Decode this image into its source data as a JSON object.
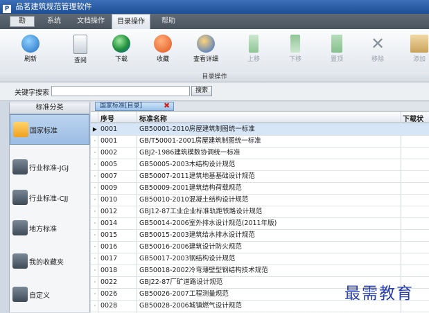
{
  "window": {
    "title": "品茗建筑规范管理软件"
  },
  "menubar": {
    "app_button": "勘",
    "items": [
      "系统",
      "文档操作",
      "目录操作",
      "帮助"
    ],
    "active": "目录操作"
  },
  "toolbar": {
    "buttons": [
      {
        "label": "刷新",
        "icon": "refresh-icon",
        "enabled": true
      },
      {
        "label": "查阅",
        "icon": "document-icon",
        "enabled": true
      },
      {
        "label": "下载",
        "icon": "globe-download-icon",
        "enabled": true
      },
      {
        "label": "收藏",
        "icon": "heart-icon",
        "enabled": true
      },
      {
        "label": "查看详细",
        "icon": "detail-icon",
        "enabled": true
      },
      {
        "label": "上移",
        "icon": "arrow-up-icon",
        "enabled": false
      },
      {
        "label": "下移",
        "icon": "arrow-down-icon",
        "enabled": false
      },
      {
        "label": "置顶",
        "icon": "arrow-top-icon",
        "enabled": false
      },
      {
        "label": "移除",
        "icon": "remove-icon",
        "enabled": false
      },
      {
        "label": "添加",
        "icon": "add-icon",
        "enabled": false
      }
    ],
    "group_label": "目录操作"
  },
  "search": {
    "label": "关键字搜索",
    "value": "",
    "button": "搜索"
  },
  "sidebar": {
    "header": "标准分类",
    "items": [
      {
        "label": "国家标准",
        "selected": true
      },
      {
        "label": "行业标准-JGJ",
        "selected": false
      },
      {
        "label": "行业标准-CJJ",
        "selected": false
      },
      {
        "label": "地方标准",
        "selected": false
      },
      {
        "label": "我的收藏夹",
        "selected": false
      },
      {
        "label": "自定义",
        "selected": false
      }
    ]
  },
  "tab": {
    "label": "国家标准[目录]"
  },
  "grid": {
    "columns": [
      "序号",
      "标准名称",
      "下载状"
    ],
    "rows": [
      {
        "no": "0001",
        "name": "GB50001-2010房屋建筑制图统一标准"
      },
      {
        "no": "0001",
        "name": "GB/T50001-2001房屋建筑制图统一标准"
      },
      {
        "no": "0002",
        "name": "GBJ2-1986建筑模数协调统一标准"
      },
      {
        "no": "0005",
        "name": "GB50005-2003木结构设计规范"
      },
      {
        "no": "0007",
        "name": "GB50007-2011建筑地基基础设计规范"
      },
      {
        "no": "0009",
        "name": "GB50009-2001建筑结构荷载规范"
      },
      {
        "no": "0010",
        "name": "GB50010-2010混凝土结构设计规范"
      },
      {
        "no": "0012",
        "name": "GBJ12-87工业企业标准轨距铁路设计规范"
      },
      {
        "no": "0014",
        "name": "GB50014-2006室外排水设计规范(2011年版)"
      },
      {
        "no": "0015",
        "name": "GB50015-2003建筑给水排水设计规范"
      },
      {
        "no": "0016",
        "name": "GB50016-2006建筑设计防火规范"
      },
      {
        "no": "0017",
        "name": "GB50017-2003钢结构设计规范"
      },
      {
        "no": "0018",
        "name": "GB50018-2002冷弯薄壁型钢结构技术规范"
      },
      {
        "no": "0022",
        "name": "GBJ22-87厂矿道路设计规范"
      },
      {
        "no": "0026",
        "name": "GB50026-2007工程测量规范"
      },
      {
        "no": "0028",
        "name": "GB50028-2006城镇燃气设计规范"
      }
    ]
  },
  "watermark": "最需教育"
}
